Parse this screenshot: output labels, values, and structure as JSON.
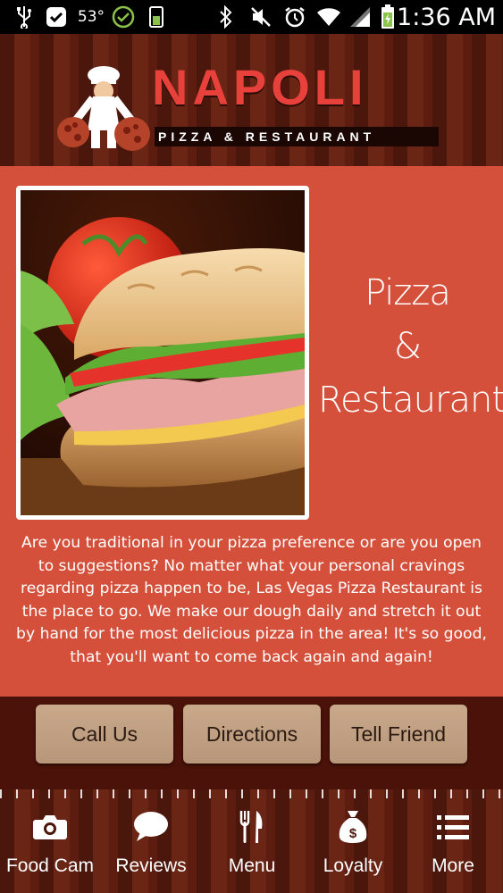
{
  "status_bar": {
    "temperature": "53°",
    "time": "1:36 AM",
    "icons": [
      "usb-icon",
      "notification-icon",
      "check-icon",
      "battery-saver-icon",
      "bluetooth-icon",
      "mute-icon",
      "alarm-icon",
      "wifi-icon",
      "signal-icon",
      "battery-icon"
    ]
  },
  "header": {
    "brand": "NAPOLI",
    "tagline": "PIZZA & RESTAURANT"
  },
  "hero": {
    "title_lines": [
      "Pizza",
      "&",
      "Restaurant"
    ],
    "description": "Are you traditional in your pizza preference or are you open to suggestions? No matter what your personal cravings regarding pizza happen to be, Las Vegas Pizza Restaurant is the place to go. We make our dough daily and stretch it out by hand for the most delicious pizza in the area! It's so good, that you'll want to come back again and again!"
  },
  "actions": {
    "call": "Call Us",
    "directions": "Directions",
    "tell_friend": "Tell Friend"
  },
  "nav": {
    "items": [
      {
        "label": "Food Cam",
        "icon": "camera-icon"
      },
      {
        "label": "Reviews",
        "icon": "chat-bubble-icon"
      },
      {
        "label": "Menu",
        "icon": "fork-knife-icon"
      },
      {
        "label": "Loyalty",
        "icon": "money-bag-icon"
      },
      {
        "label": "More",
        "icon": "list-icon"
      }
    ]
  },
  "colors": {
    "brand_red": "#e8413c",
    "panel": "#d4503a",
    "button": "#c4a484"
  }
}
